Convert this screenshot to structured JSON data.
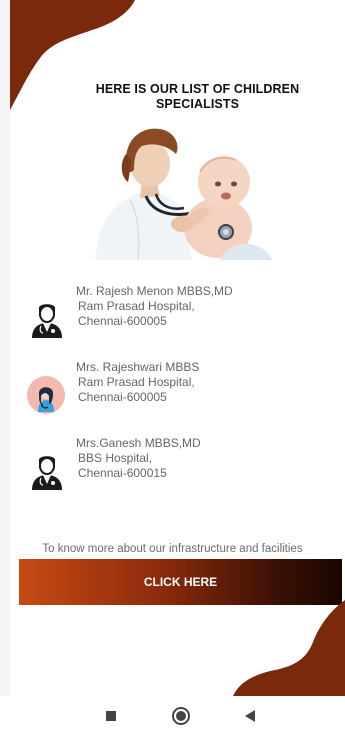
{
  "title": "HERE IS OUR LIST OF CHILDREN SPECIALISTS",
  "doctors": [
    {
      "name": "Mr. Rajesh Menon MBBS,MD",
      "hospital": "Ram Prasad Hospital,",
      "city": "Chennai-600005",
      "icon": "male-doctor-icon"
    },
    {
      "name": "Mrs. Rajeshwari MBBS",
      "hospital": "Ram Prasad Hospital,",
      "city": "Chennai-600005",
      "icon": "female-doctor-avatar-icon"
    },
    {
      "name": "Mrs.Ganesh MBBS,MD",
      "hospital": "BBS Hospital,",
      "city": "Chennai-600015",
      "icon": "male-doctor-icon"
    }
  ],
  "info_text": "To know more about our infrastructure and facilities",
  "button": {
    "label": "CLICK HERE"
  },
  "colors": {
    "brand": "#7a2a0a",
    "button_start": "#c84a14",
    "button_end": "#1a0602"
  },
  "navbar": {
    "items": [
      "recents-square-icon",
      "home-circle-icon",
      "back-triangle-icon"
    ]
  }
}
